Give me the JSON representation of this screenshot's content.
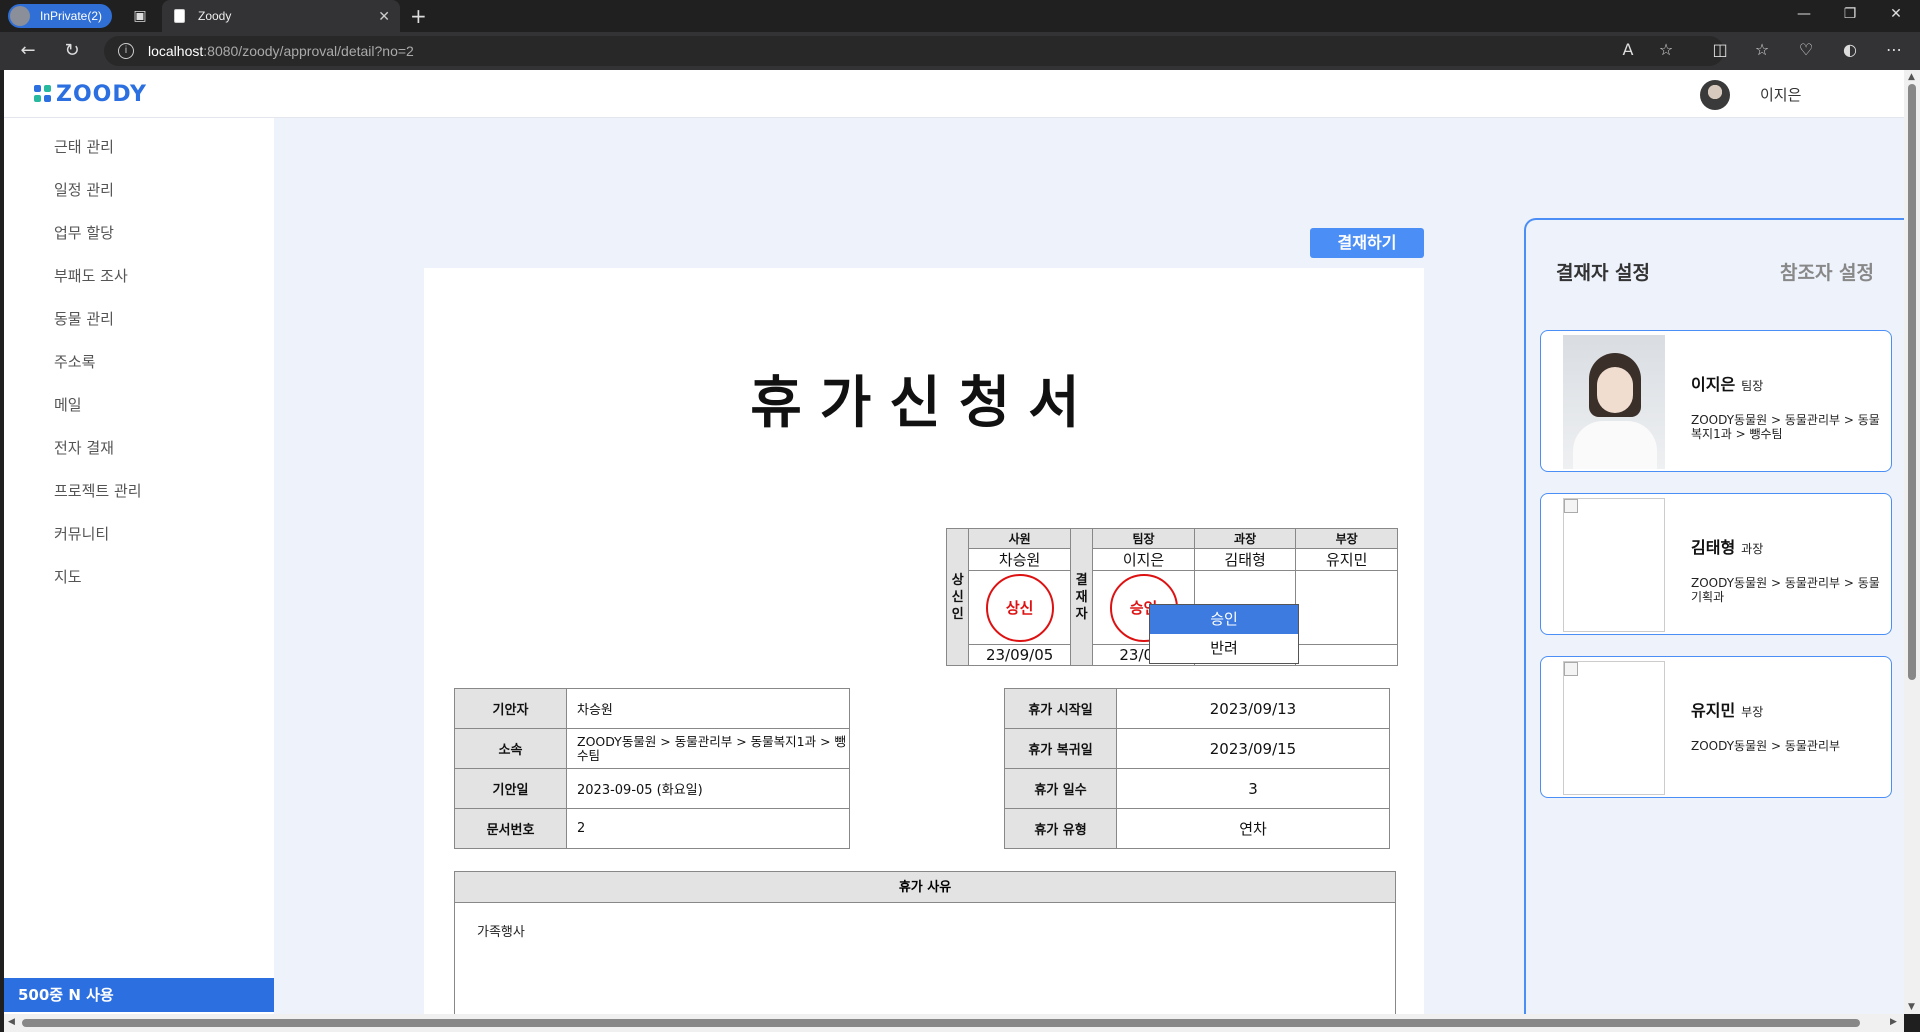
{
  "browser": {
    "inprivate_label": "InPrivate(2)",
    "tab_title": "Zoody",
    "url_host": "localhost",
    "url_path": ":8080/zoody/approval/detail?no=2"
  },
  "header": {
    "logo": "ZOODY",
    "user_name": "이지은"
  },
  "sidebar": {
    "items": [
      "근태 관리",
      "일정 관리",
      "업무 할당",
      "부패도 조사",
      "동물 관리",
      "주소록",
      "메일",
      "전자 결재",
      "프로젝트 관리",
      "커뮤니티",
      "지도"
    ],
    "footer": "500중 N 사용"
  },
  "approve_button": "결재하기",
  "document": {
    "title": "휴가신청서",
    "sign": {
      "submitter_label": "상신인",
      "approver_label": "결재자",
      "ranks": [
        "사원",
        "팀장",
        "과장",
        "부장"
      ],
      "names": [
        "차승원",
        "이지은",
        "김태형",
        "유지민"
      ],
      "stamps": [
        "상신",
        "승인"
      ],
      "dates": [
        "23/09/05",
        "23/09/"
      ]
    },
    "left_info": [
      {
        "label": "기안자",
        "value": "차승원"
      },
      {
        "label": "소속",
        "value": "ZOODY동물원 > 동물관리부 > 동물복지1과 > 뺑수팀"
      },
      {
        "label": "기안일",
        "value": "2023-09-05 (화요일)"
      },
      {
        "label": "문서번호",
        "value": "2"
      }
    ],
    "right_info": [
      {
        "label": "휴가 시작일",
        "value": "2023/09/13"
      },
      {
        "label": "휴가 복귀일",
        "value": "2023/09/15"
      },
      {
        "label": "휴가 일수",
        "value": "3"
      },
      {
        "label": "휴가 유형",
        "value": "연차"
      }
    ],
    "reason_header": "휴가 사유",
    "reason_body": "가족행사"
  },
  "popup": {
    "options": [
      "승인",
      "반려"
    ],
    "selected": "승인"
  },
  "right_panel": {
    "tab_approvers": "결재자 설정",
    "tab_references": "참조자 설정",
    "cards": [
      {
        "name": "이지은",
        "rank": "팀장",
        "dept": "ZOODY동물원 > 동물관리부 > 동물복지1과 > 뺑수팀"
      },
      {
        "name": "김태형",
        "rank": "과장",
        "dept": "ZOODY동물원 > 동물관리부 > 동물기획과"
      },
      {
        "name": "유지민",
        "rank": "부장",
        "dept": "ZOODY동물원 > 동물관리부"
      }
    ]
  },
  "colors": {
    "accent": "#2b6fe0",
    "button": "#4b8ef5",
    "stamp": "#dd1111",
    "page_bg": "#eef3fb"
  }
}
